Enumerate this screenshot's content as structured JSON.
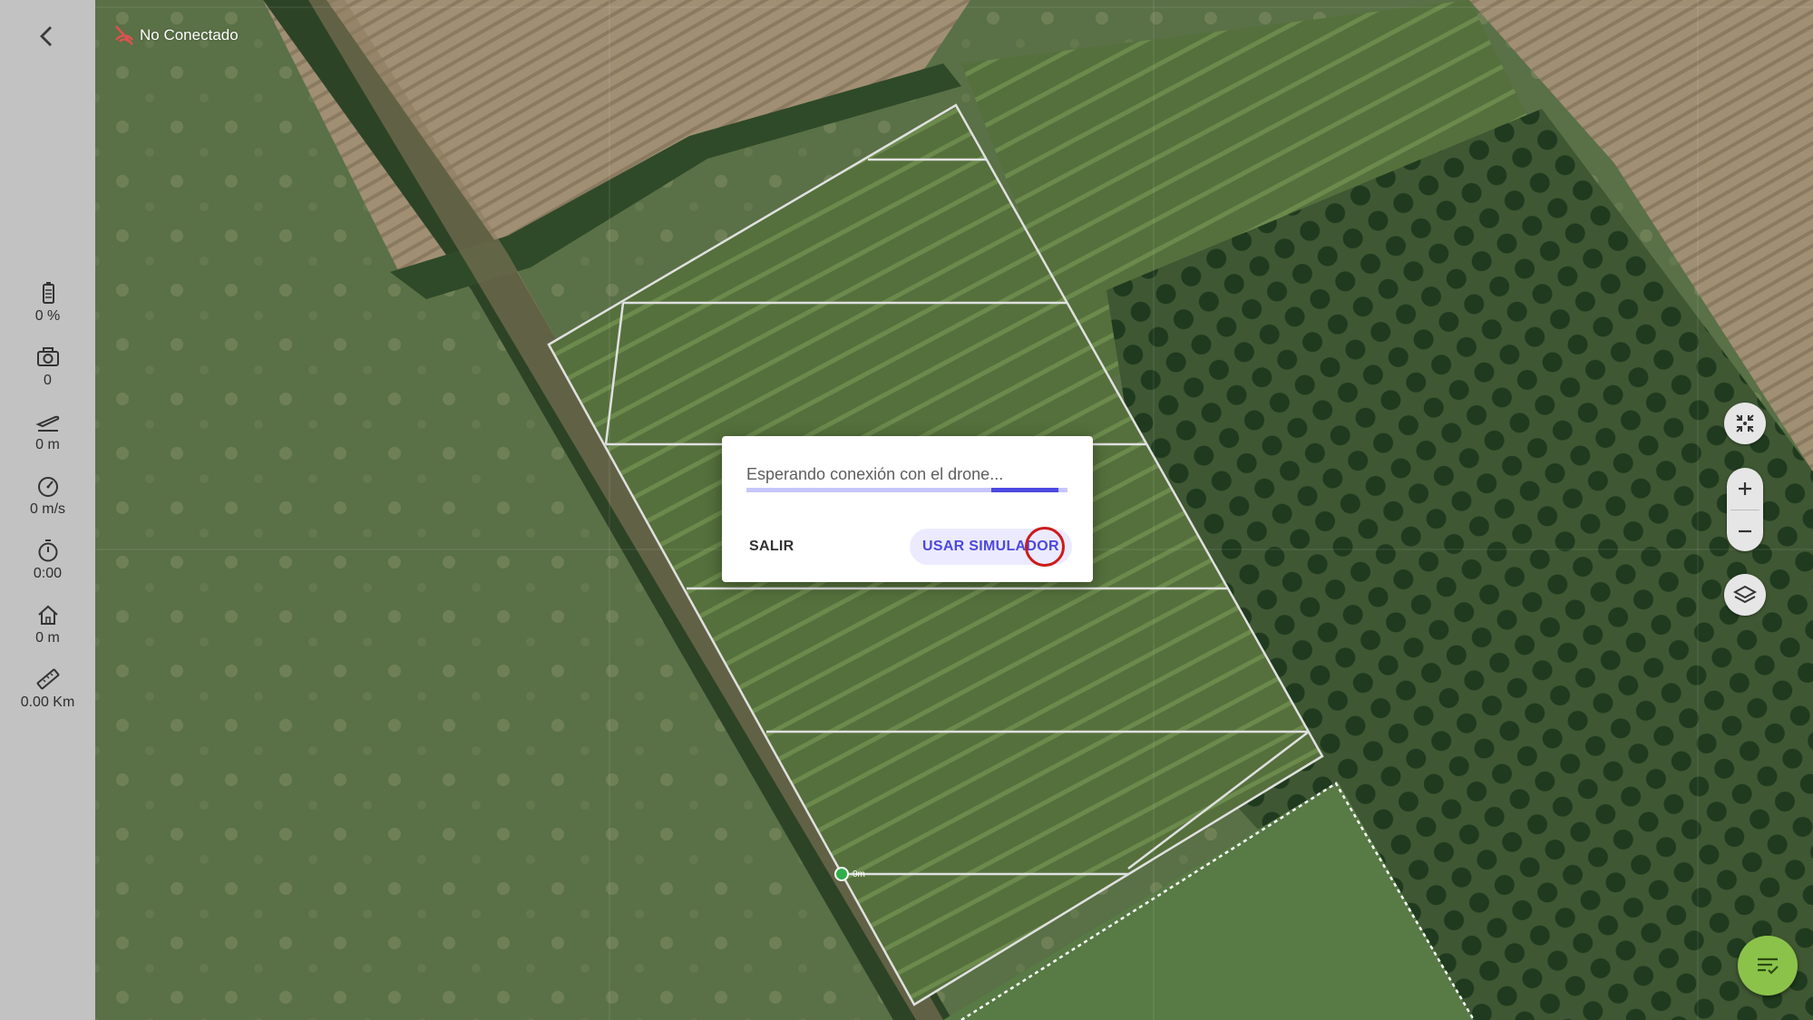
{
  "status": {
    "connection_text": "No Conectado",
    "icon": "no-signal-icon"
  },
  "sidebar": {
    "back_icon": "chevron-left-icon",
    "telemetry": [
      {
        "icon": "battery-icon",
        "value": "0 %"
      },
      {
        "icon": "camera-icon",
        "value": "0"
      },
      {
        "icon": "takeoff-icon",
        "value": "0 m"
      },
      {
        "icon": "speedometer-icon",
        "value": "0 m/s"
      },
      {
        "icon": "timer-icon",
        "value": "0:00"
      },
      {
        "icon": "home-icon",
        "value": "0 m"
      },
      {
        "icon": "ruler-icon",
        "value": "0.00 Km"
      }
    ]
  },
  "dialog": {
    "message": "Esperando conexión con el drone...",
    "progress_indeterminate": true,
    "exit_label": "SALIR",
    "simulator_label": "USAR SIMULADOR"
  },
  "map": {
    "home_marker_label": "0m",
    "controls": [
      "fit-to-area-icon",
      "zoom-in-icon",
      "zoom-out-icon",
      "layers-icon"
    ],
    "fab_icon": "mission-list-icon"
  },
  "colors": {
    "accent": "#4c48e0",
    "accent_light": "#c7c5ff",
    "fab": "#8bc34a",
    "sidebar": "#c2c2c2"
  }
}
